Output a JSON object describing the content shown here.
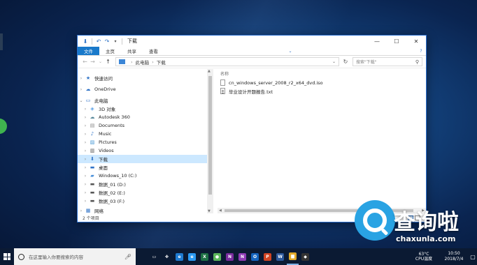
{
  "window": {
    "title": "下载",
    "controls": {
      "minimize": "—",
      "maximize": "☐",
      "close": "✕"
    }
  },
  "ribbon": {
    "tabs": [
      {
        "label": "文件",
        "active": true
      },
      {
        "label": "主页",
        "active": false
      },
      {
        "label": "共享",
        "active": false
      },
      {
        "label": "查看",
        "active": false
      }
    ],
    "help": "?"
  },
  "address": {
    "segments": [
      "此电脑",
      "下载"
    ],
    "separator": "›",
    "search_placeholder": "搜索\"下载\""
  },
  "nav": {
    "items": [
      {
        "label": "快速访问",
        "icon": "star-icon",
        "level": 0,
        "selected": false
      },
      {
        "label": "OneDrive",
        "icon": "cloud-icon",
        "level": 0,
        "selected": false
      },
      {
        "label": "此电脑",
        "icon": "computer-icon",
        "level": 0,
        "selected": false
      },
      {
        "label": "3D 对象",
        "icon": "cube-icon",
        "level": 1,
        "selected": false
      },
      {
        "label": "Autodesk 360",
        "icon": "cloud-drive-icon",
        "level": 1,
        "selected": false
      },
      {
        "label": "Documents",
        "icon": "document-icon",
        "level": 1,
        "selected": false
      },
      {
        "label": "Music",
        "icon": "music-icon",
        "level": 1,
        "selected": false
      },
      {
        "label": "Pictures",
        "icon": "picture-icon",
        "level": 1,
        "selected": false
      },
      {
        "label": "Videos",
        "icon": "video-icon",
        "level": 1,
        "selected": false
      },
      {
        "label": "下载",
        "icon": "download-icon",
        "level": 1,
        "selected": true
      },
      {
        "label": "桌面",
        "icon": "desktop-icon",
        "level": 1,
        "selected": false
      },
      {
        "label": "Windows_10 (C:)",
        "icon": "drive-icon",
        "level": 1,
        "selected": false
      },
      {
        "label": "数据_01 (D:)",
        "icon": "drive-icon",
        "level": 1,
        "selected": false
      },
      {
        "label": "数据_02 (E:)",
        "icon": "drive-icon",
        "level": 1,
        "selected": false
      },
      {
        "label": "数据_03 (F:)",
        "icon": "drive-icon",
        "level": 1,
        "selected": false
      },
      {
        "label": "网络",
        "icon": "network-icon",
        "level": 0,
        "selected": false
      }
    ]
  },
  "content": {
    "column_header": "名称",
    "files": [
      {
        "name": "cn_windows_server_2008_r2_x64_dvd.iso",
        "icon": "disc-image-file-icon"
      },
      {
        "name": "毕业设计开题报告.txt",
        "icon": "text-file-icon"
      }
    ]
  },
  "status": {
    "item_count": "2 个项目"
  },
  "watermark": {
    "brand": "查询啦",
    "url": "chaxunla.com"
  },
  "taskbar": {
    "search_placeholder": "在这里输入你要搜索的内容",
    "apps": [
      {
        "name": "task-view",
        "glyph": "▭",
        "color": "#0b1a33"
      },
      {
        "name": "fan-app",
        "glyph": "✤",
        "color": "#0b1a33"
      },
      {
        "name": "edge",
        "glyph": "e",
        "color": "#1f7bd1"
      },
      {
        "name": "ie",
        "glyph": "e",
        "color": "#2b9af3"
      },
      {
        "name": "excel",
        "glyph": "X",
        "color": "#1e7145"
      },
      {
        "name": "app-green",
        "glyph": "●",
        "color": "#5bb55b"
      },
      {
        "name": "onenote",
        "glyph": "N",
        "color": "#7a2c9e"
      },
      {
        "name": "onenote-2",
        "glyph": "N",
        "color": "#8e3bb4"
      },
      {
        "name": "outlook",
        "glyph": "O",
        "color": "#1565c0"
      },
      {
        "name": "powerpoint",
        "glyph": "P",
        "color": "#d04423"
      },
      {
        "name": "word",
        "glyph": "W",
        "color": "#2b579a"
      },
      {
        "name": "file-explorer",
        "glyph": "▆",
        "color": "#e0a92a",
        "active": true
      },
      {
        "name": "app-dark",
        "glyph": "◆",
        "color": "#333333"
      }
    ],
    "weather_temp": "63°C",
    "weather_label": "CPU温度",
    "time": "10:50",
    "date": "2018/7/4"
  }
}
